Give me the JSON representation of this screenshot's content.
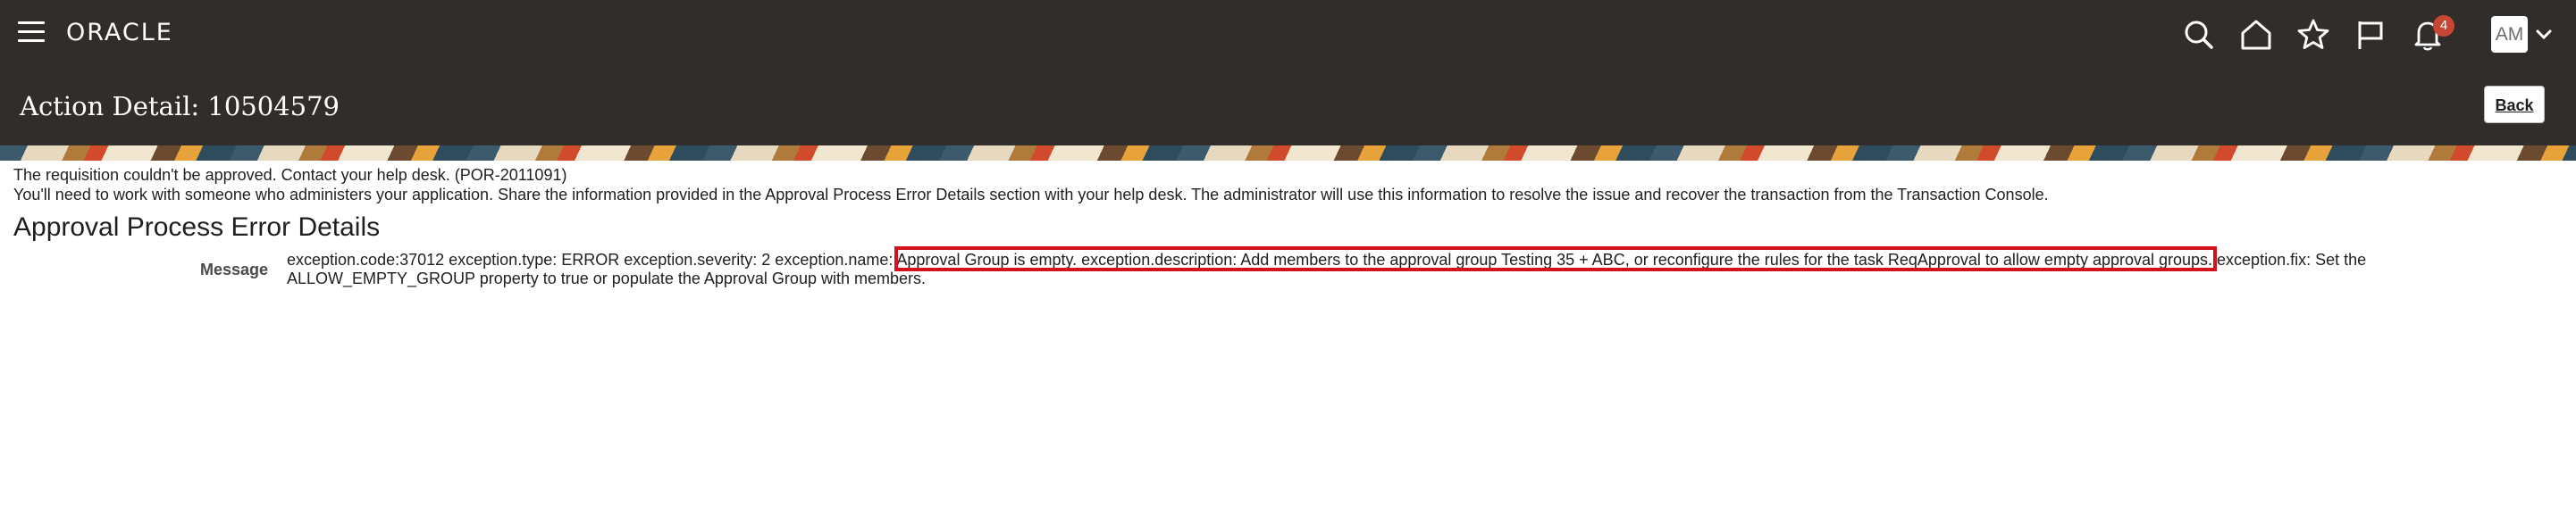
{
  "topbar": {
    "logo": "ORACLE",
    "notifications_count": "4",
    "avatar_initials": "AM",
    "icons": [
      "menu-icon",
      "search-icon",
      "home-icon",
      "favorites-icon",
      "flag-icon",
      "bell-icon",
      "chevron-down-icon"
    ]
  },
  "header": {
    "title": "Action Detail: 10504579",
    "back_label": "Back"
  },
  "messages": {
    "line1": "The requisition couldn't be approved. Contact your help desk. (POR-2011091)",
    "line2": "You'll need to work with someone who administers your application. Share the information provided in the Approval Process Error Details section with your help desk. The administrator will use this information to resolve the issue and recover the transaction from the Transaction Console."
  },
  "section": {
    "title": "Approval Process Error Details",
    "message_label": "Message",
    "message_value": "exception.code:37012 exception.type: ERROR exception.severity: 2 exception.name: Approval Group is empty. exception.description: Add members to the approval group Testing 35 + ABC, or reconfigure the rules for the task ReqApproval to allow empty approval groups. exception.fix: Set the ALLOW_EMPTY_GROUP property to true or populate the Approval Group with members."
  },
  "colors": {
    "bar": "#312d2a",
    "badge": "#c74634",
    "highlight": "#d3121e"
  }
}
